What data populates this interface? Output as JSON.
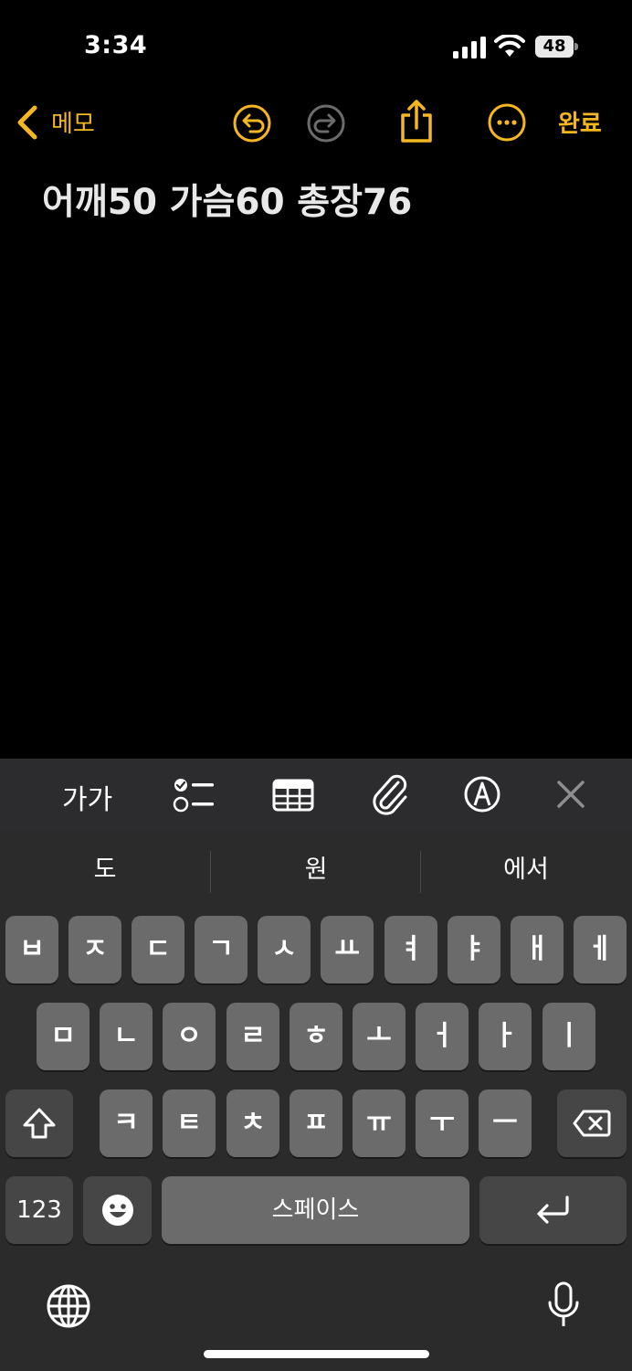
{
  "status_bar": {
    "time": "3:34",
    "battery": "48"
  },
  "nav": {
    "back_label": "메모",
    "done_label": "완료"
  },
  "note": {
    "text": "어깨50 가슴60 총장76"
  },
  "format_toolbar": {
    "text_style_label": "가가"
  },
  "suggestions": [
    "도",
    "원",
    "에서"
  ],
  "keyboard": {
    "row1": [
      "ㅂ",
      "ㅈ",
      "ㄷ",
      "ㄱ",
      "ㅅ",
      "ㅛ",
      "ㅕ",
      "ㅑ",
      "ㅐ",
      "ㅔ"
    ],
    "row2": [
      "ㅁ",
      "ㄴ",
      "ㅇ",
      "ㄹ",
      "ㅎ",
      "ㅗ",
      "ㅓ",
      "ㅏ",
      "ㅣ"
    ],
    "row3": [
      "ㅋ",
      "ㅌ",
      "ㅊ",
      "ㅍ",
      "ㅠ",
      "ㅜ",
      "ㅡ"
    ],
    "numbers_label": "123",
    "space_label": "스페이스"
  },
  "colors": {
    "accent": "#f5b71f",
    "background": "#000000",
    "keyboard_bg": "#2b2b2b",
    "key_bg": "#6b6b6b",
    "key_dark_bg": "#464646"
  }
}
